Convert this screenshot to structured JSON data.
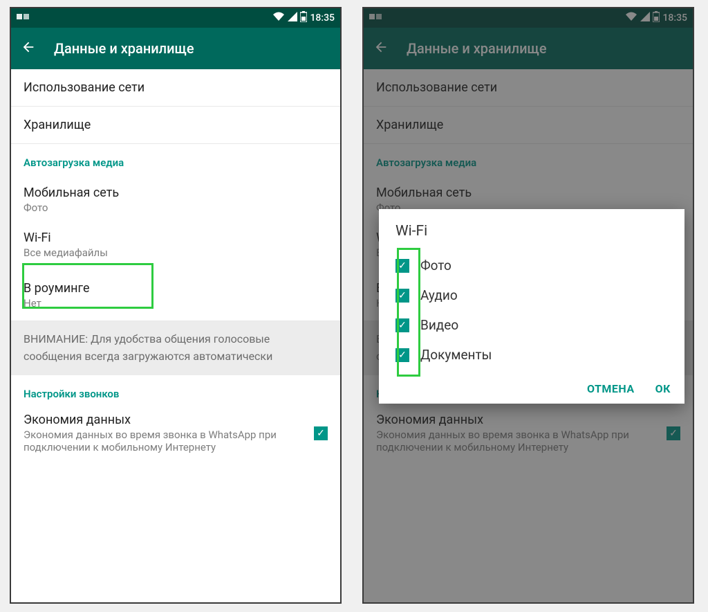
{
  "status": {
    "time": "18:35"
  },
  "appbar": {
    "title": "Данные и хранилище"
  },
  "rows": {
    "network_usage": "Использование сети",
    "storage": "Хранилище"
  },
  "sections": {
    "autodownload": "Автозагрузка медиа",
    "call_settings": "Настройки звонков"
  },
  "autodownload": {
    "mobile": {
      "title": "Мобильная сеть",
      "sub": "Фото"
    },
    "wifi": {
      "title": "Wi-Fi",
      "sub": "Все медиафайлы"
    },
    "roaming": {
      "title": "В роуминге",
      "sub": "Нет"
    }
  },
  "info_note": "ВНИМАНИЕ: Для удобства общения голосовые сообщения всегда загружаются автоматически",
  "low_data": {
    "title": "Экономия данных",
    "sub": "Экономия данных во время звонка в WhatsApp при подключении к мобильному Интернету"
  },
  "dialog": {
    "title": "Wi-Fi",
    "items": [
      "Фото",
      "Аудио",
      "Видео",
      "Документы"
    ],
    "cancel": "ОТМЕНА",
    "ok": "ОК"
  }
}
